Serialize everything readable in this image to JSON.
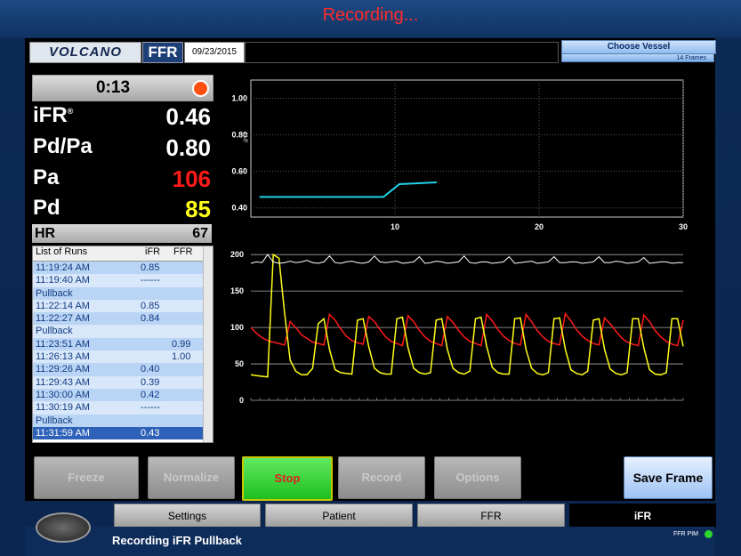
{
  "window_title": "Recording...",
  "header": {
    "logo_text": "VOLCANO",
    "mode": "FFR",
    "date": "09/23/2015",
    "choose_vessel_label": "Choose Vessel",
    "frames_label": "14 Frames"
  },
  "timer": {
    "time": "0:13"
  },
  "metrics": {
    "ifr_label": "iFR",
    "ifr_sup": "®",
    "ifr_value": "0.46",
    "pdpa_label": "Pd/Pa",
    "pdpa_value": "0.80",
    "pa_label": "Pa",
    "pa_value": "106",
    "pd_label": "Pd",
    "pd_value": "85",
    "hr_label": "HR",
    "hr_value": "67"
  },
  "runs": {
    "title": "List of Runs",
    "col_ifr": "iFR",
    "col_ffr": "FFR",
    "rows": [
      {
        "time": "11:19:24 AM",
        "ifr": "0.85",
        "ffr": ""
      },
      {
        "time": "11:19:40 AM",
        "ifr": "------",
        "ffr": ""
      },
      {
        "time": "Pullback",
        "ifr": "",
        "ffr": ""
      },
      {
        "time": "11:22:14 AM",
        "ifr": "0.85",
        "ffr": ""
      },
      {
        "time": "11:22:27 AM",
        "ifr": "0.84",
        "ffr": ""
      },
      {
        "time": "Pullback",
        "ifr": "",
        "ffr": ""
      },
      {
        "time": "11:23:51 AM",
        "ifr": "",
        "ffr": "0.99"
      },
      {
        "time": "11:26:13 AM",
        "ifr": "",
        "ffr": "1.00"
      },
      {
        "time": "11:29:26 AM",
        "ifr": "0.40",
        "ffr": ""
      },
      {
        "time": "11:29:43 AM",
        "ifr": "0.39",
        "ffr": ""
      },
      {
        "time": "11:30:00 AM",
        "ifr": "0.42",
        "ffr": ""
      },
      {
        "time": "11:30:19 AM",
        "ifr": "------",
        "ffr": ""
      },
      {
        "time": "Pullback",
        "ifr": "",
        "ffr": ""
      },
      {
        "time": "11:31:59 AM",
        "ifr": "0.43",
        "ffr": ""
      }
    ]
  },
  "trend_chart": {
    "y_axis_label": "iFR",
    "y_ticks": [
      "1.00",
      "0.80",
      "0.60",
      "0.40"
    ],
    "x_ticks": [
      "10",
      "20",
      "30"
    ],
    "color": "#21d0e8"
  },
  "waveform_chart": {
    "y_ticks": [
      "200",
      "150",
      "100",
      "50",
      "0"
    ],
    "colors": {
      "pa": "#ff1a1a",
      "pd": "#ffff1a",
      "ecg": "#ffffff"
    }
  },
  "buttons": {
    "freeze": "Freeze",
    "normalize": "Normalize",
    "stop": "Stop",
    "record": "Record",
    "options": "Options",
    "save_frame": "Save Frame"
  },
  "tabs": [
    "Settings",
    "Patient",
    "FFR",
    "iFR"
  ],
  "active_tab": "iFR",
  "status_text": "Recording iFR Pullback",
  "pim_label": "FFR PIM",
  "chart_data": [
    {
      "type": "line",
      "ylabel": "iFR",
      "ylim": [
        0.35,
        1.1
      ],
      "xlim": [
        0,
        30
      ],
      "series": [
        {
          "x": [
            0.6,
            9.2,
            10.3,
            12.9
          ],
          "values": [
            0.46,
            0.46,
            0.53,
            0.54
          ]
        }
      ]
    },
    {
      "type": "line",
      "ylim": [
        0,
        210
      ],
      "series": [
        {
          "values": [
            100,
            92,
            86,
            82,
            80,
            78,
            76,
            108,
            100,
            90,
            85,
            80,
            78,
            76,
            118,
            110,
            98,
            88,
            82,
            79,
            77,
            115,
            108,
            97,
            87,
            81,
            78,
            75,
            116,
            108,
            96,
            87,
            81,
            78,
            75,
            115,
            107,
            96,
            87,
            81,
            78,
            75,
            118,
            109,
            97,
            88,
            82,
            78,
            76,
            118,
            108,
            96,
            87,
            81,
            78,
            76,
            119,
            109,
            97,
            88,
            82,
            78,
            76,
            113,
            105,
            95,
            86,
            80,
            77,
            75,
            117,
            108,
            96,
            87,
            81,
            77,
            75,
            110
          ]
        },
        {
          "values": [
            35,
            34,
            33,
            32,
            200,
            195,
            120,
            55,
            40,
            35,
            35,
            44,
            105,
            112,
            70,
            42,
            38,
            37,
            36,
            110,
            112,
            74,
            44,
            38,
            36,
            36,
            112,
            114,
            72,
            44,
            38,
            36,
            38,
            110,
            112,
            70,
            44,
            38,
            36,
            40,
            112,
            114,
            74,
            45,
            38,
            36,
            36,
            112,
            113,
            70,
            44,
            37,
            35,
            38,
            112,
            113,
            70,
            42,
            37,
            35,
            40,
            110,
            112,
            70,
            43,
            37,
            35,
            38,
            112,
            112,
            72,
            42,
            36,
            35,
            38,
            112,
            112,
            74
          ]
        },
        {
          "values": [
            188,
            190,
            189,
            200,
            190,
            188,
            189,
            191,
            189,
            190,
            192,
            189,
            188,
            190,
            198,
            189,
            188,
            190,
            191,
            189,
            188,
            190,
            198,
            190,
            189,
            190,
            191,
            188,
            189,
            190,
            197,
            188,
            189,
            191,
            190,
            188,
            189,
            190,
            198,
            189,
            188,
            190,
            190,
            188,
            189,
            190,
            197,
            188,
            189,
            190,
            191,
            188,
            189,
            190,
            197,
            189,
            189,
            190,
            190,
            188,
            189,
            190,
            197,
            189,
            189,
            191,
            190,
            188,
            189,
            190,
            196,
            188,
            189,
            190,
            190,
            188,
            189,
            189
          ]
        }
      ]
    }
  ]
}
